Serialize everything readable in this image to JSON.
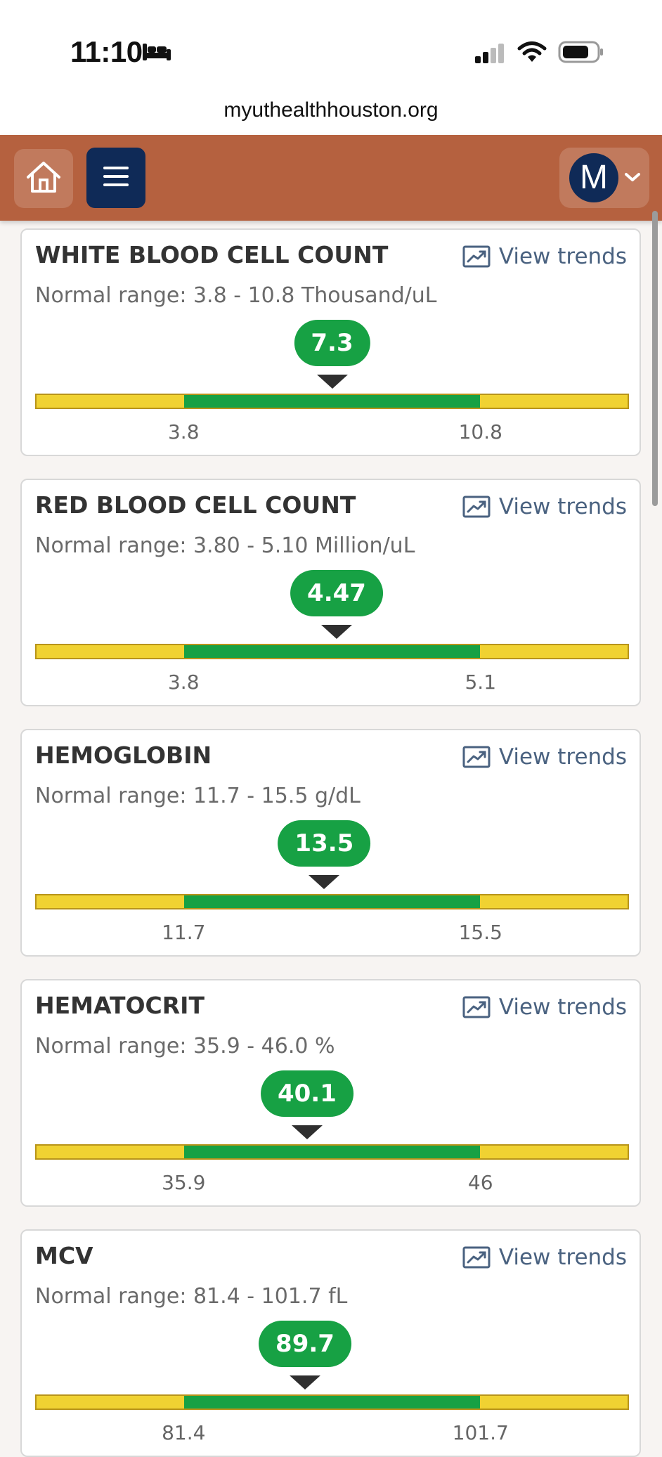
{
  "status_bar": {
    "time": "11:10"
  },
  "browser": {
    "url": "myuthealthhouston.org"
  },
  "nav": {
    "avatar_initial": "M"
  },
  "trend_label": "View trends",
  "results": [
    {
      "name": "WHITE BLOOD CELL COUNT",
      "range_text": "Normal range: 3.8 - 10.8 Thousand/uL",
      "value": "7.3",
      "value_num": 7.3,
      "low": 3.8,
      "high": 10.8,
      "low_label": "3.8",
      "high_label": "10.8"
    },
    {
      "name": "RED BLOOD CELL COUNT",
      "range_text": "Normal range: 3.80 - 5.10 Million/uL",
      "value": "4.47",
      "value_num": 4.47,
      "low": 3.8,
      "high": 5.1,
      "low_label": "3.8",
      "high_label": "5.1"
    },
    {
      "name": "HEMOGLOBIN",
      "range_text": "Normal range: 11.7 - 15.5 g/dL",
      "value": "13.5",
      "value_num": 13.5,
      "low": 11.7,
      "high": 15.5,
      "low_label": "11.7",
      "high_label": "15.5"
    },
    {
      "name": "HEMATOCRIT",
      "range_text": "Normal range: 35.9 - 46.0 %",
      "value": "40.1",
      "value_num": 40.1,
      "low": 35.9,
      "high": 46.0,
      "low_label": "35.9",
      "high_label": "46"
    },
    {
      "name": "MCV",
      "range_text": "Normal range: 81.4 - 101.7 fL",
      "value": "89.7",
      "value_num": 89.7,
      "low": 81.4,
      "high": 101.7,
      "low_label": "81.4",
      "high_label": "101.7"
    }
  ],
  "colors": {
    "nav": "#b5613f",
    "menu_button": "#0f2a57",
    "normal": "#17a144",
    "out_of_range": "#f0d232",
    "link": "#4a6280"
  }
}
